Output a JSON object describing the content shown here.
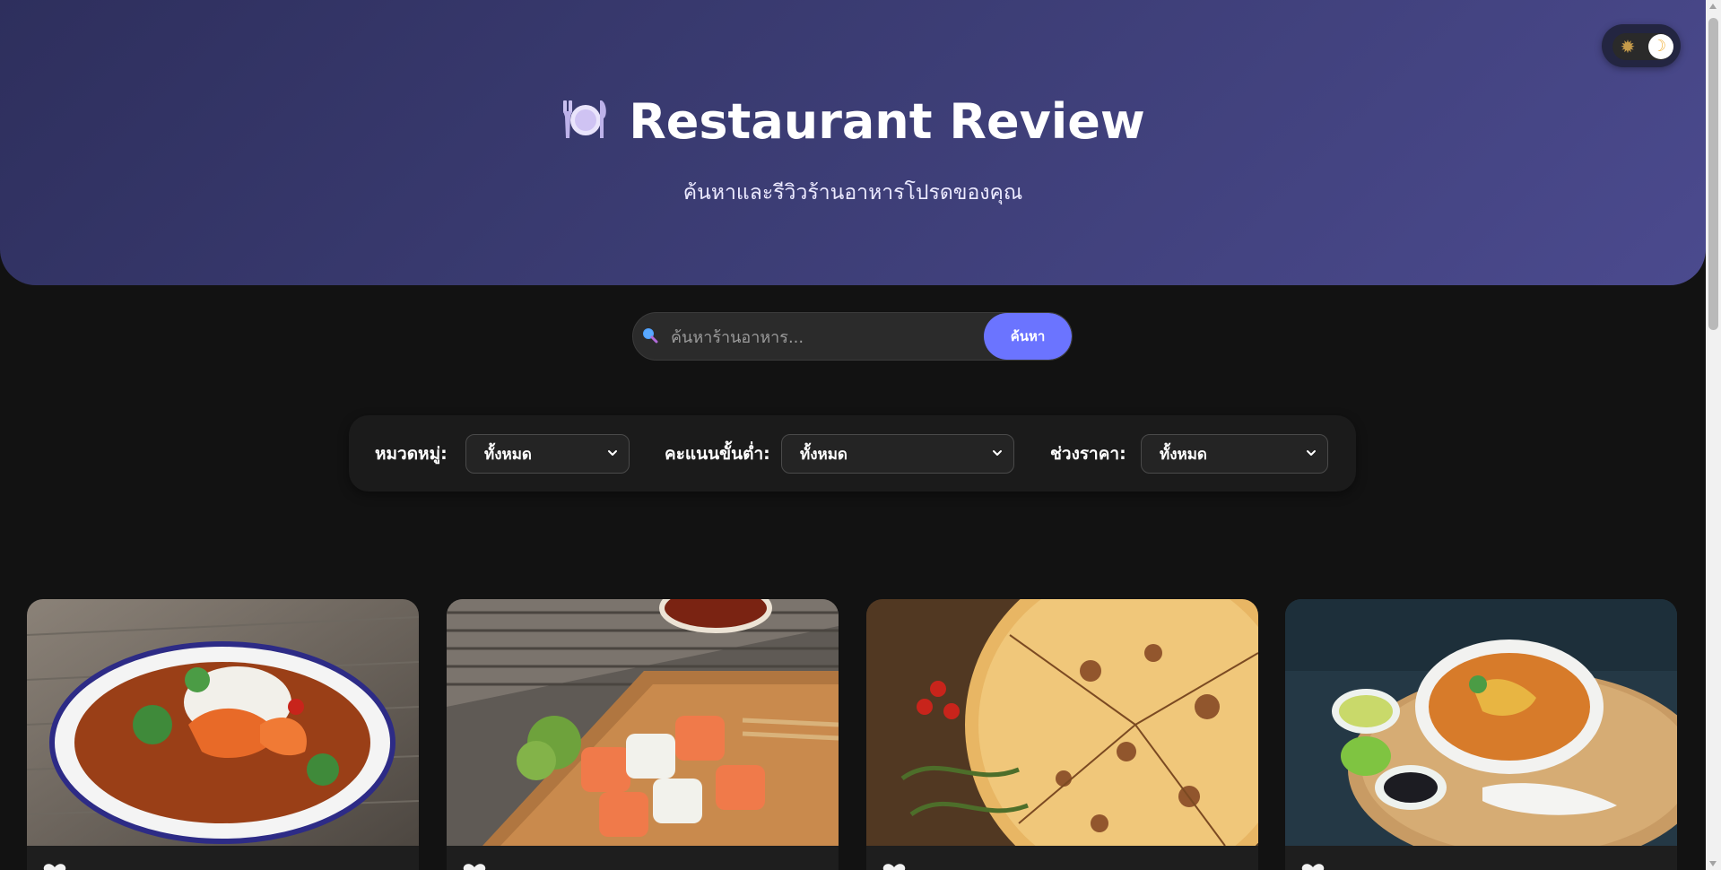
{
  "header": {
    "title": "Restaurant Review",
    "subtitle": "ค้นหาและรีวิวร้านอาหารโปรดของคุณ",
    "title_icon": "plate-cutlery-icon"
  },
  "theme_toggle": {
    "sun_icon": "sun-icon",
    "moon_icon": "moon-icon",
    "mode": "dark"
  },
  "search": {
    "placeholder": "ค้นหาร้านอาหาร...",
    "value": "",
    "button_label": "ค้นหา"
  },
  "filters": {
    "category": {
      "label": "หมวดหมู่:",
      "value": "ทั้งหมด"
    },
    "min_rating": {
      "label": "คะแนนขั้นต่ำ:",
      "value": "ทั้งหมด"
    },
    "price_range": {
      "label": "ช่วงราคา:",
      "value": "ทั้งหมด"
    }
  },
  "cards": [
    {
      "image": "curry-shrimp-rice-bowl"
    },
    {
      "image": "salmon-sushi-board"
    },
    {
      "image": "pizza-with-tomatoes"
    },
    {
      "image": "khao-soi-noodle-bowl"
    }
  ],
  "colors": {
    "background": "#121212",
    "accent": "#6b74ff",
    "header_gradient_start": "#2e2f5d",
    "header_gradient_end": "#4b4a8e"
  }
}
